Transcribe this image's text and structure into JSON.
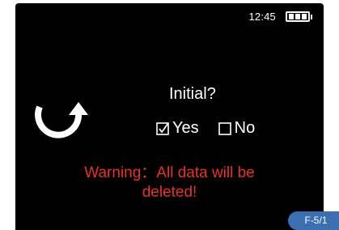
{
  "status_bar": {
    "time": "12:45",
    "battery_icon": "battery-full-icon",
    "battery_level": 1.0
  },
  "back_icon": "undo-arrow-icon",
  "dialog": {
    "question": "Initial?",
    "options": [
      {
        "label": "Yes",
        "checked": true
      },
      {
        "label": "No",
        "checked": false
      }
    ]
  },
  "warning": {
    "line1": "Warning：All data will be",
    "line2": "deleted!"
  },
  "page_tag": "F-5/1",
  "colors": {
    "screen_bg": "#000000",
    "text": "#ffffff",
    "warning": "#e8322b",
    "tag_bg": "#3c6fb2"
  }
}
